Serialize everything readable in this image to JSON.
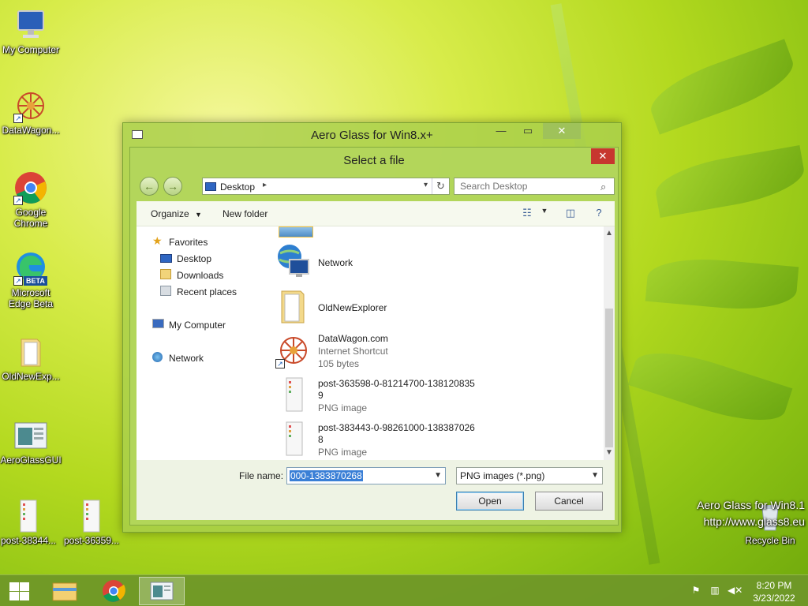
{
  "desktop": {
    "icons": [
      {
        "label": "My Computer"
      },
      {
        "label": "DataWagon..."
      },
      {
        "label": "Google Chrome"
      },
      {
        "label": "Microsoft Edge Beta"
      },
      {
        "label": "OldNewExp..."
      },
      {
        "label": "AeroGlassGUI"
      },
      {
        "label": "post-38344..."
      },
      {
        "label": "post-36359..."
      },
      {
        "label": "Recycle Bin"
      }
    ],
    "edge_badge": "BETA",
    "watermark": {
      "line1": "Aero Glass for Win8.1",
      "line2": "http://www.glass8.eu"
    }
  },
  "outer_window": {
    "title": "Aero Glass for Win8.x+"
  },
  "dialog": {
    "title": "Select a file",
    "address": {
      "location": "Desktop"
    },
    "search": {
      "placeholder": "Search Desktop"
    },
    "toolbar": {
      "organize": "Organize",
      "new_folder": "New folder"
    },
    "nav": {
      "favorites": "Favorites",
      "desktop": "Desktop",
      "downloads": "Downloads",
      "recent": "Recent places",
      "my_computer": "My Computer",
      "network": "Network"
    },
    "files": [
      {
        "name": "Network"
      },
      {
        "name": "OldNewExplorer"
      },
      {
        "name": "DataWagon.com",
        "type": "Internet Shortcut",
        "size": "105 bytes"
      },
      {
        "name": "post-363598-0-81214700-138120835",
        "name2": "9",
        "type": "PNG image"
      },
      {
        "name": "post-383443-0-98261000-138387026",
        "name2": "8",
        "type": "PNG image"
      }
    ],
    "filename": {
      "label": "File name:",
      "value": "000-1383870268"
    },
    "filetype": {
      "value": "PNG images (*.png)"
    },
    "buttons": {
      "open": "Open",
      "cancel": "Cancel"
    }
  },
  "taskbar": {
    "time": "8:20 PM",
    "date": "3/23/2022"
  }
}
